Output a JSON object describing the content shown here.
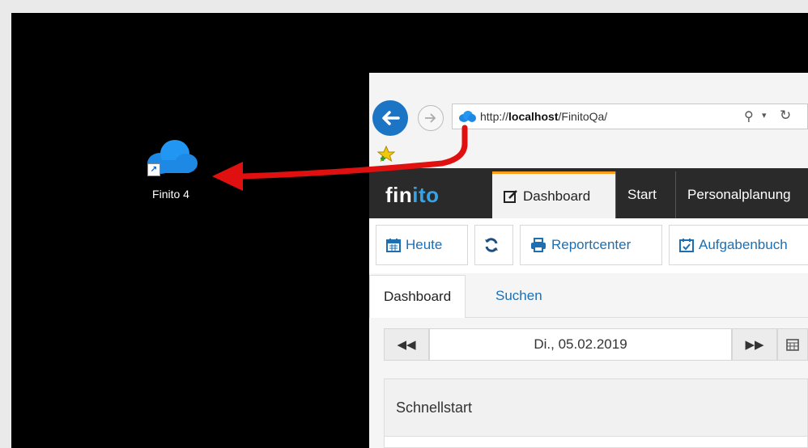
{
  "desktop": {
    "icon_label": "Finito 4"
  },
  "browser": {
    "url_prefix": "http://",
    "url_host": "localhost",
    "url_path": "/FinitoQa/"
  },
  "app": {
    "logo_fin": "fin",
    "logo_ito": "ito",
    "nav": [
      "Dashboard",
      "Start",
      "Personalplanung"
    ],
    "toolbar": {
      "today": "Heute",
      "report": "Reportcenter",
      "tasks": "Aufgabenbuch"
    },
    "tabs": [
      "Dashboard",
      "Suchen"
    ],
    "date": "Di., 05.02.2019",
    "panel_title": "Schnellstart"
  },
  "colors": {
    "accent_blue": "#1c74c4",
    "link_blue": "#1c6fb3",
    "logo_blue": "#35a3e6",
    "active_tab_orange": "#ff9c1a",
    "arrow_red": "#e01010"
  }
}
